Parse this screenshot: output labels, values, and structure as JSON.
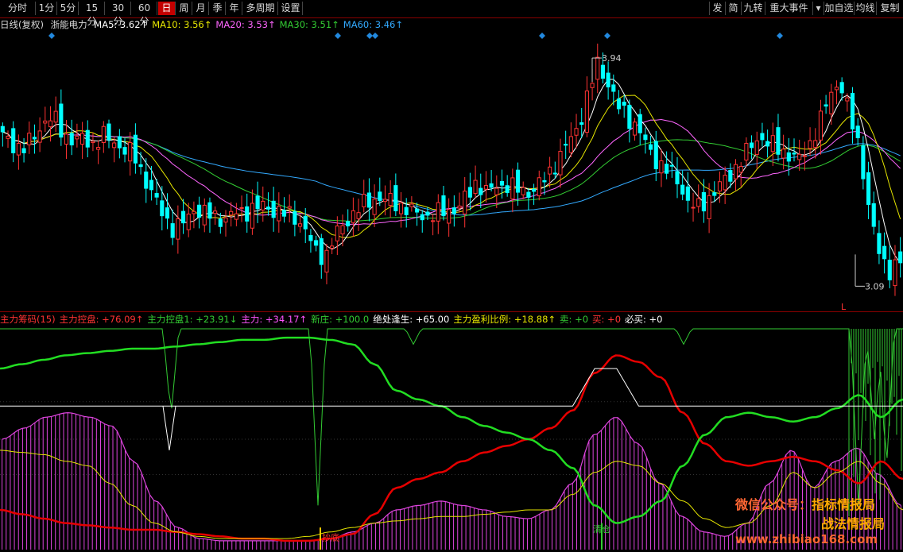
{
  "toolbar": {
    "periods": [
      {
        "label": "分时",
        "active": false
      },
      {
        "label": "1分",
        "active": false
      },
      {
        "label": "5分",
        "active": false
      },
      {
        "label": "15分",
        "active": false
      },
      {
        "label": "30分",
        "active": false
      },
      {
        "label": "60分",
        "active": false
      },
      {
        "label": "日",
        "active": true
      },
      {
        "label": "周",
        "active": false
      },
      {
        "label": "月",
        "active": false
      },
      {
        "label": "季",
        "active": false
      },
      {
        "label": "年",
        "active": false
      },
      {
        "label": "多周期",
        "active": false
      },
      {
        "label": "设置",
        "active": false
      }
    ],
    "right_buttons": [
      "发",
      "简",
      "九转",
      "重大事件",
      "▾",
      "加自选",
      "均线",
      "复制"
    ]
  },
  "price_legend": {
    "chart_name": "日线(复权)",
    "stock_name": "浙能电力",
    "items": [
      {
        "text": "MA5: 3.62↑",
        "color": "#ffffff"
      },
      {
        "text": "MA10: 3.56↑",
        "color": "#e6e600"
      },
      {
        "text": "MA20: 3.53↑",
        "color": "#ff66ff"
      },
      {
        "text": "MA30: 3.51↑",
        "color": "#33cc33"
      },
      {
        "text": "MA60: 3.46↑",
        "color": "#33aaff"
      }
    ]
  },
  "indicator_legend": {
    "items": [
      {
        "text": "主力筹码(15)",
        "color": "#ff3333"
      },
      {
        "text": "主力控盘: +76.09↑",
        "color": "#ff3333"
      },
      {
        "text": "主力控盘1: +23.91↓",
        "color": "#33cc33"
      },
      {
        "text": "主力: +34.17↑",
        "color": "#ff55ff"
      },
      {
        "text": "新庄: +100.0",
        "color": "#33cc33"
      },
      {
        "text": "绝处逢生: +65.00",
        "color": "#ffffff"
      },
      {
        "text": "主力盈利比例: +18.88↑",
        "color": "#e6e600"
      },
      {
        "text": "卖: +0",
        "color": "#33cc33"
      },
      {
        "text": "买: +0",
        "color": "#ff3333"
      },
      {
        "text": "必买: +0",
        "color": "#ffffff"
      }
    ]
  },
  "annotations": {
    "high_label": "3.94",
    "low_label": "3.09",
    "low_marker": "L",
    "bottom_label": "抄底",
    "clear_label": "清仓"
  },
  "watermarks": {
    "line1_a": "微信公众号：",
    "line1_b": "指标情报局",
    "line2": "战法情报局",
    "line3": "www.zhibiao168.com"
  },
  "colors": {
    "up": "#ff3333",
    "down": "#00ffff",
    "ma5": "#ffffff",
    "ma10": "#e6e600",
    "ma20": "#ff66ff",
    "ma30": "#33cc33",
    "ma60": "#33aaff",
    "main_control": "#e60000",
    "main_control1": "#22dd22",
    "main_bars": "#dd44dd",
    "xinzhuang": "#33cc33",
    "profit_ratio": "#e6e600",
    "jue_chu": "#ffffff"
  },
  "chart_data": [
    {
      "type": "candlestick",
      "price_range": [
        3.09,
        3.94
      ],
      "price_annotations": [
        {
          "label": "3.94",
          "value": 3.94
        },
        {
          "label": "3.09",
          "value": 3.09
        }
      ],
      "close_path": [
        3.65,
        3.62,
        3.6,
        3.64,
        3.7,
        3.72,
        3.66,
        3.63,
        3.64,
        3.62,
        3.65,
        3.63,
        3.6,
        3.58,
        3.5,
        3.42,
        3.35,
        3.3,
        3.33,
        3.38,
        3.36,
        3.35,
        3.34,
        3.36,
        3.37,
        3.38,
        3.39,
        3.37,
        3.36,
        3.35,
        3.3,
        3.22,
        3.2,
        3.28,
        3.33,
        3.37,
        3.4,
        3.42,
        3.41,
        3.4,
        3.38,
        3.36,
        3.35,
        3.36,
        3.37,
        3.38,
        3.42,
        3.48,
        3.44,
        3.46,
        3.47,
        3.45,
        3.44,
        3.46,
        3.5,
        3.56,
        3.62,
        3.68,
        3.8,
        3.92,
        3.85,
        3.76,
        3.72,
        3.68,
        3.6,
        3.55,
        3.52,
        3.48,
        3.4,
        3.38,
        3.42,
        3.46,
        3.5,
        3.55,
        3.6,
        3.65,
        3.62,
        3.6,
        3.58,
        3.56,
        3.62,
        3.7,
        3.8,
        3.86,
        3.72,
        3.6,
        3.35,
        3.2,
        3.15,
        3.18
      ],
      "moving_averages": [
        "MA5",
        "MA10",
        "MA20",
        "MA30",
        "MA60"
      ],
      "signal_markers": 7
    },
    {
      "type": "line",
      "series": [
        {
          "name": "主力控盘",
          "values": [
            18,
            16,
            14,
            12,
            11,
            10,
            9,
            9,
            8,
            7,
            6,
            5,
            5,
            4,
            4,
            5,
            7,
            16,
            28,
            32,
            35,
            40,
            44,
            47,
            50,
            55,
            63,
            80,
            88,
            85,
            78,
            62,
            48,
            40,
            38,
            40,
            42,
            40,
            36,
            30,
            40,
            32
          ]
        },
        {
          "name": "主力控盘1",
          "values": [
            82,
            84,
            86,
            88,
            89,
            90,
            91,
            91,
            92,
            93,
            94,
            95,
            95,
            96,
            96,
            95,
            93,
            84,
            72,
            68,
            65,
            60,
            56,
            53,
            50,
            45,
            37,
            20,
            12,
            15,
            22,
            38,
            52,
            60,
            62,
            60,
            58,
            60,
            64,
            70,
            60,
            68
          ]
        },
        {
          "name": "主力盈利比例",
          "values": [
            45,
            44,
            43,
            40,
            38,
            30,
            20,
            12,
            8,
            6,
            5,
            5,
            5,
            5,
            6,
            8,
            10,
            12,
            13,
            14,
            15,
            15,
            16,
            17,
            18,
            18,
            25,
            35,
            40,
            38,
            30,
            22,
            14,
            10,
            12,
            20,
            35,
            28,
            35,
            40,
            30,
            18
          ]
        },
        {
          "name": "绝处逢生",
          "values": [
            65,
            65,
            65,
            65,
            65,
            65,
            65,
            65,
            65,
            65,
            65,
            65,
            65,
            65,
            65,
            65,
            65,
            65,
            65,
            65,
            65,
            65,
            65,
            65,
            65,
            65,
            65,
            82,
            82,
            65,
            65,
            65,
            65,
            65,
            65,
            65,
            65,
            65,
            65,
            65,
            65,
            65
          ]
        }
      ],
      "bars": {
        "name": "主力",
        "values": [
          50,
          55,
          60,
          62,
          60,
          56,
          40,
          22,
          10,
          5,
          4,
          4,
          4,
          4,
          4,
          5,
          8,
          12,
          18,
          20,
          22,
          20,
          18,
          15,
          14,
          18,
          30,
          52,
          60,
          48,
          30,
          15,
          8,
          6,
          12,
          30,
          45,
          28,
          40,
          46,
          34,
          20
        ]
      },
      "ylim": [
        0,
        100
      ]
    }
  ]
}
